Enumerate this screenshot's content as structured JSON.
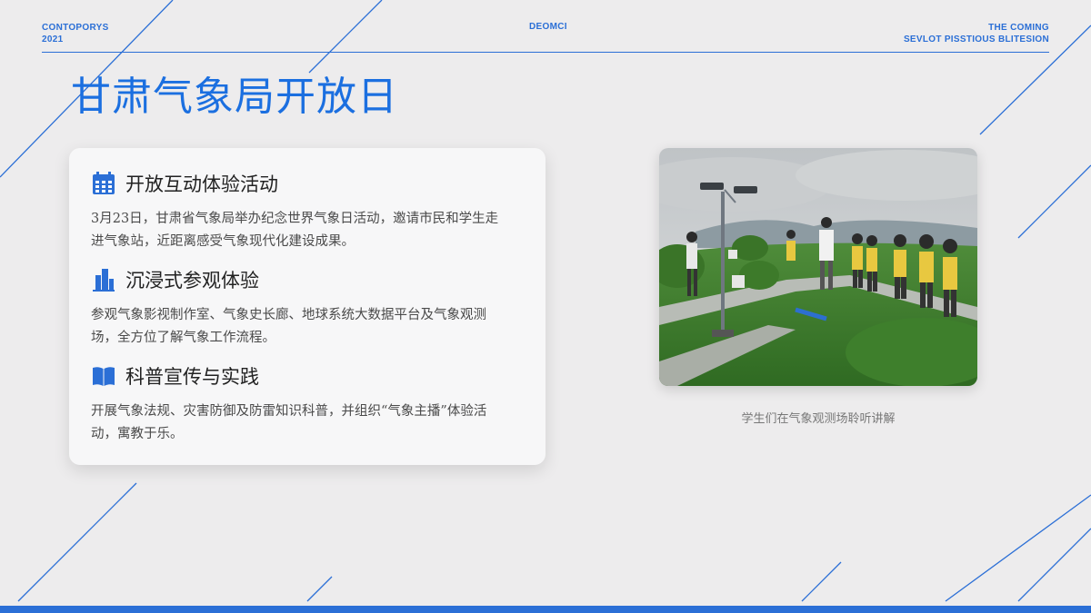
{
  "header": {
    "left_line1": "CONTOPORYS",
    "left_line2": "2021",
    "center": "DEOMCI",
    "right_line1": "THE COMING",
    "right_line2": "SEVLOT PISSTIOUS BLITESION"
  },
  "title": "甘肃气象局开放日",
  "items": [
    {
      "icon": "calendar-icon",
      "title": "开放互动体验活动",
      "body": "3月23日，甘肃省气象局举办纪念世界气象日活动，邀请市民和学生走进气象站，近距离感受气象现代化建设成果。"
    },
    {
      "icon": "building-icon",
      "title": "沉浸式参观体验",
      "body": "参观气象影视制作室、气象史长廊、地球系统大数据平台及气象观测场，全方位了解气象工作流程。"
    },
    {
      "icon": "book-icon",
      "title": "科普宣传与实践",
      "body": "开展气象法规、灾害防御及防雷知识科普，并组织“气象主播”体验活动，寓教于乐。"
    }
  ],
  "photo_caption": "学生们在气象观测场聆听讲解",
  "colors": {
    "accent": "#2b6fd6",
    "title": "#1b6fe0",
    "background": "#edeced"
  }
}
